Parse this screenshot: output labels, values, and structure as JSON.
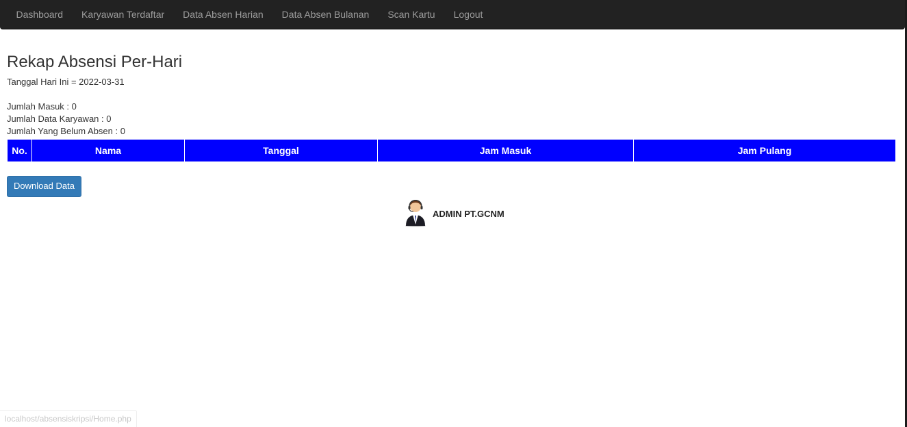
{
  "nav": {
    "items": [
      {
        "label": "Dashboard"
      },
      {
        "label": "Karyawan Terdaftar"
      },
      {
        "label": "Data Absen Harian"
      },
      {
        "label": "Data Absen Bulanan"
      },
      {
        "label": "Scan Kartu"
      },
      {
        "label": "Logout"
      }
    ],
    "background": "#222222",
    "text_color": "#9d9d9d"
  },
  "page": {
    "title": "Rekap Absensi Per-Hari",
    "date_line": "Tanggal Hari Ini = 2022-03-31",
    "stats": {
      "masuk": "Jumlah Masuk : 0",
      "karyawan": "Jumlah Data Karyawan : 0",
      "belum_absen": "Jumlah Yang Belum Absen : 0"
    }
  },
  "table": {
    "header_color": "#0000ff",
    "columns": [
      "No.",
      "Nama",
      "Tanggal",
      "Jam Masuk",
      "Jam Pulang"
    ],
    "rows": []
  },
  "download_button": {
    "label": "Download Data",
    "color": "#337ab7"
  },
  "admin": {
    "icon": "user-avatar-icon",
    "name": "ADMIN PT.GCNM"
  },
  "status_bar": {
    "url": "localhost/absensiskripsi/Home.php"
  }
}
